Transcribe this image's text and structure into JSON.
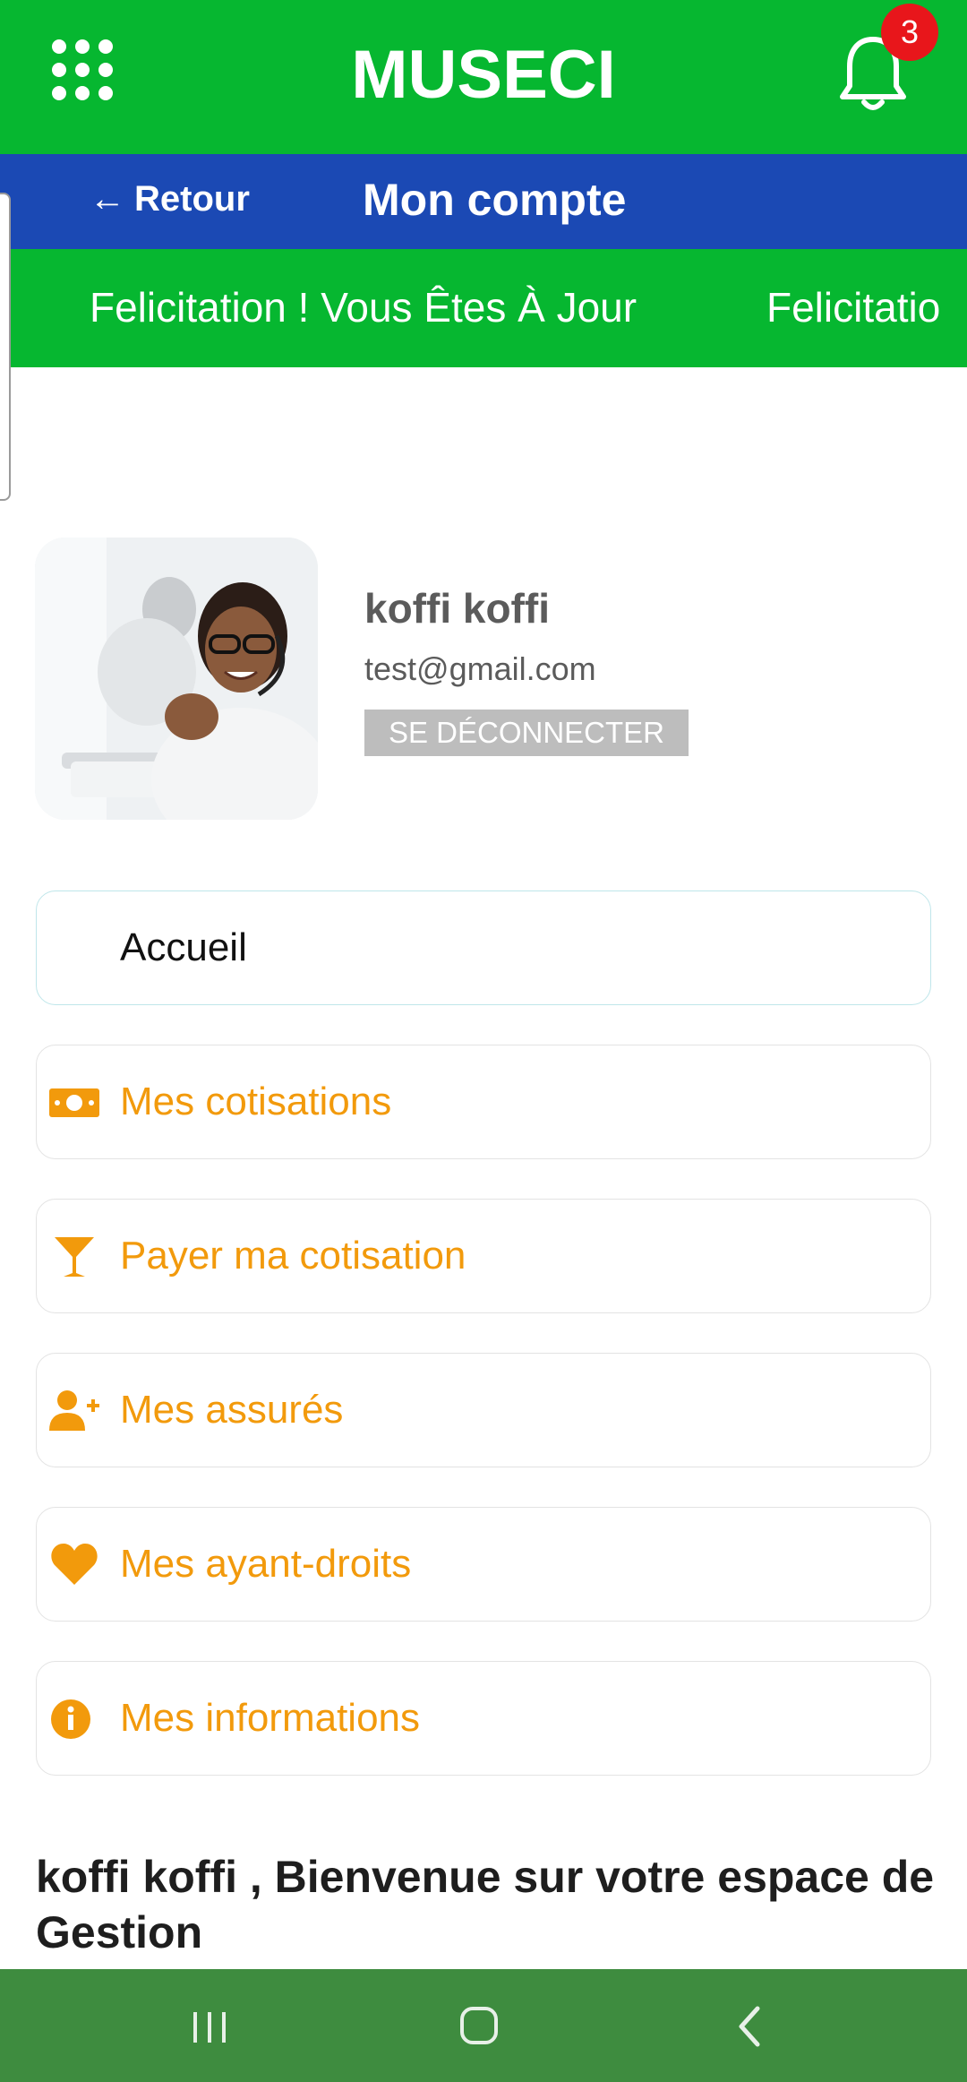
{
  "header": {
    "title": "MUSECI",
    "notification_count": "3",
    "menu_icon": "grid-icon",
    "bell_icon": "bell-icon",
    "bg_color": "#06b730"
  },
  "subheader": {
    "back_label": "Retour",
    "title": "Mon compte",
    "bg_color": "#1b49b4"
  },
  "marquee": {
    "items": [
      "Felicitation ! Vous Êtes À Jour",
      "Felicitatio"
    ]
  },
  "profile": {
    "name": "koffi koffi",
    "email": "test@gmail.com",
    "logout_label": "SE DÉCONNECTER"
  },
  "menu": [
    {
      "label": "Accueil",
      "icon": ""
    },
    {
      "label": "Mes cotisations",
      "icon": "money-bill-icon"
    },
    {
      "label": "Payer ma cotisation",
      "icon": "cocktail-glass-icon"
    },
    {
      "label": "Mes assurés",
      "icon": "user-plus-icon"
    },
    {
      "label": "Mes ayant-droits",
      "icon": "heart-icon"
    },
    {
      "label": "Mes informations",
      "icon": "info-circle-icon"
    }
  ],
  "welcome": {
    "text": "koffi koffi  , Bienvenue sur votre espace de Gestion"
  },
  "colors": {
    "accent_orange": "#f29a0c",
    "nav_bar": "#3e8c3f"
  }
}
